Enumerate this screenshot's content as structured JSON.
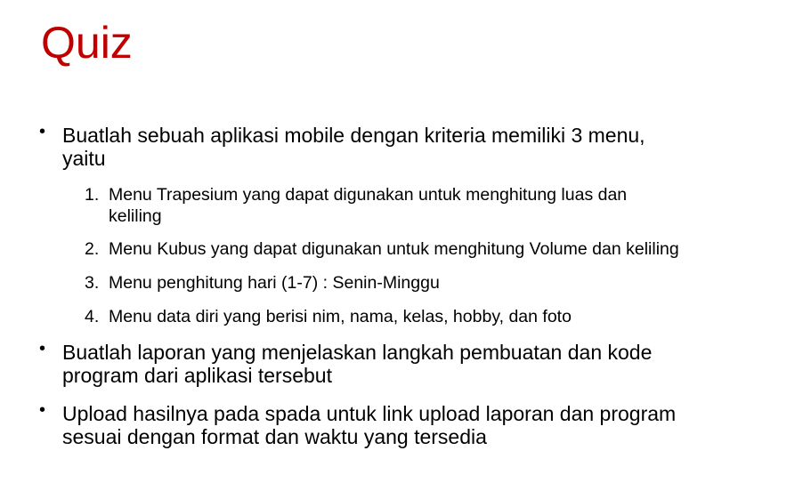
{
  "title": "Quiz",
  "bullets": [
    {
      "symbol": "•",
      "lines": [
        "Buatlah sebuah aplikasi mobile dengan kriteria memiliki 3 menu,",
        "yaitu"
      ]
    },
    {
      "symbol": "•",
      "lines": [
        "Buatlah laporan yang menjelaskan langkah pembuatan dan kode",
        "program dari aplikasi tersebut"
      ]
    },
    {
      "symbol": "•",
      "lines": [
        "Upload hasilnya pada spada untuk link upload laporan dan program",
        "sesuai dengan format dan waktu yang tersedia"
      ]
    }
  ],
  "sub_items": [
    {
      "number": "1.",
      "lines": [
        "Menu Trapesium yang dapat digunakan untuk menghitung luas dan",
        "keliling"
      ]
    },
    {
      "number": "2.",
      "lines": [
        "Menu Kubus yang dapat digunakan untuk menghitung Volume dan keliling"
      ]
    },
    {
      "number": "3.",
      "lines": [
        "Menu penghitung hari (1-7) : Senin-Minggu"
      ]
    },
    {
      "number": "4.",
      "lines": [
        "Menu data diri yang berisi nim, nama, kelas, hobby, dan foto"
      ]
    }
  ],
  "colors": {
    "title": "#c00000",
    "text": "#000000"
  }
}
